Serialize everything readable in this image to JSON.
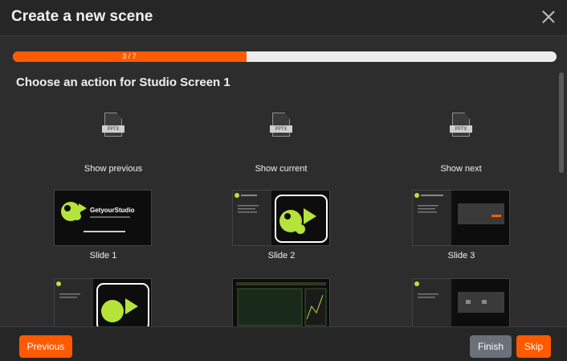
{
  "dialog": {
    "title": "Create a new scene"
  },
  "progress": {
    "text": "3 / 7",
    "fraction": 0.43
  },
  "heading": "Choose an action for Studio Screen 1",
  "actions": [
    {
      "label": "Show previous",
      "icon": "pptx-icon",
      "tag": "PPTX"
    },
    {
      "label": "Show current",
      "icon": "pptx-icon",
      "tag": "PPTX"
    },
    {
      "label": "Show next",
      "icon": "pptx-icon",
      "tag": "PPTX"
    }
  ],
  "slides": [
    {
      "label": "Slide 1",
      "logo_text": "GetyourStudio"
    },
    {
      "label": "Slide 2"
    },
    {
      "label": "Slide 3"
    }
  ],
  "footer": {
    "previous": "Previous",
    "finish": "Finish",
    "skip": "Skip"
  },
  "colors": {
    "accent": "#ff5a00",
    "lime": "#b6e33a",
    "finish": "#6b7079"
  }
}
